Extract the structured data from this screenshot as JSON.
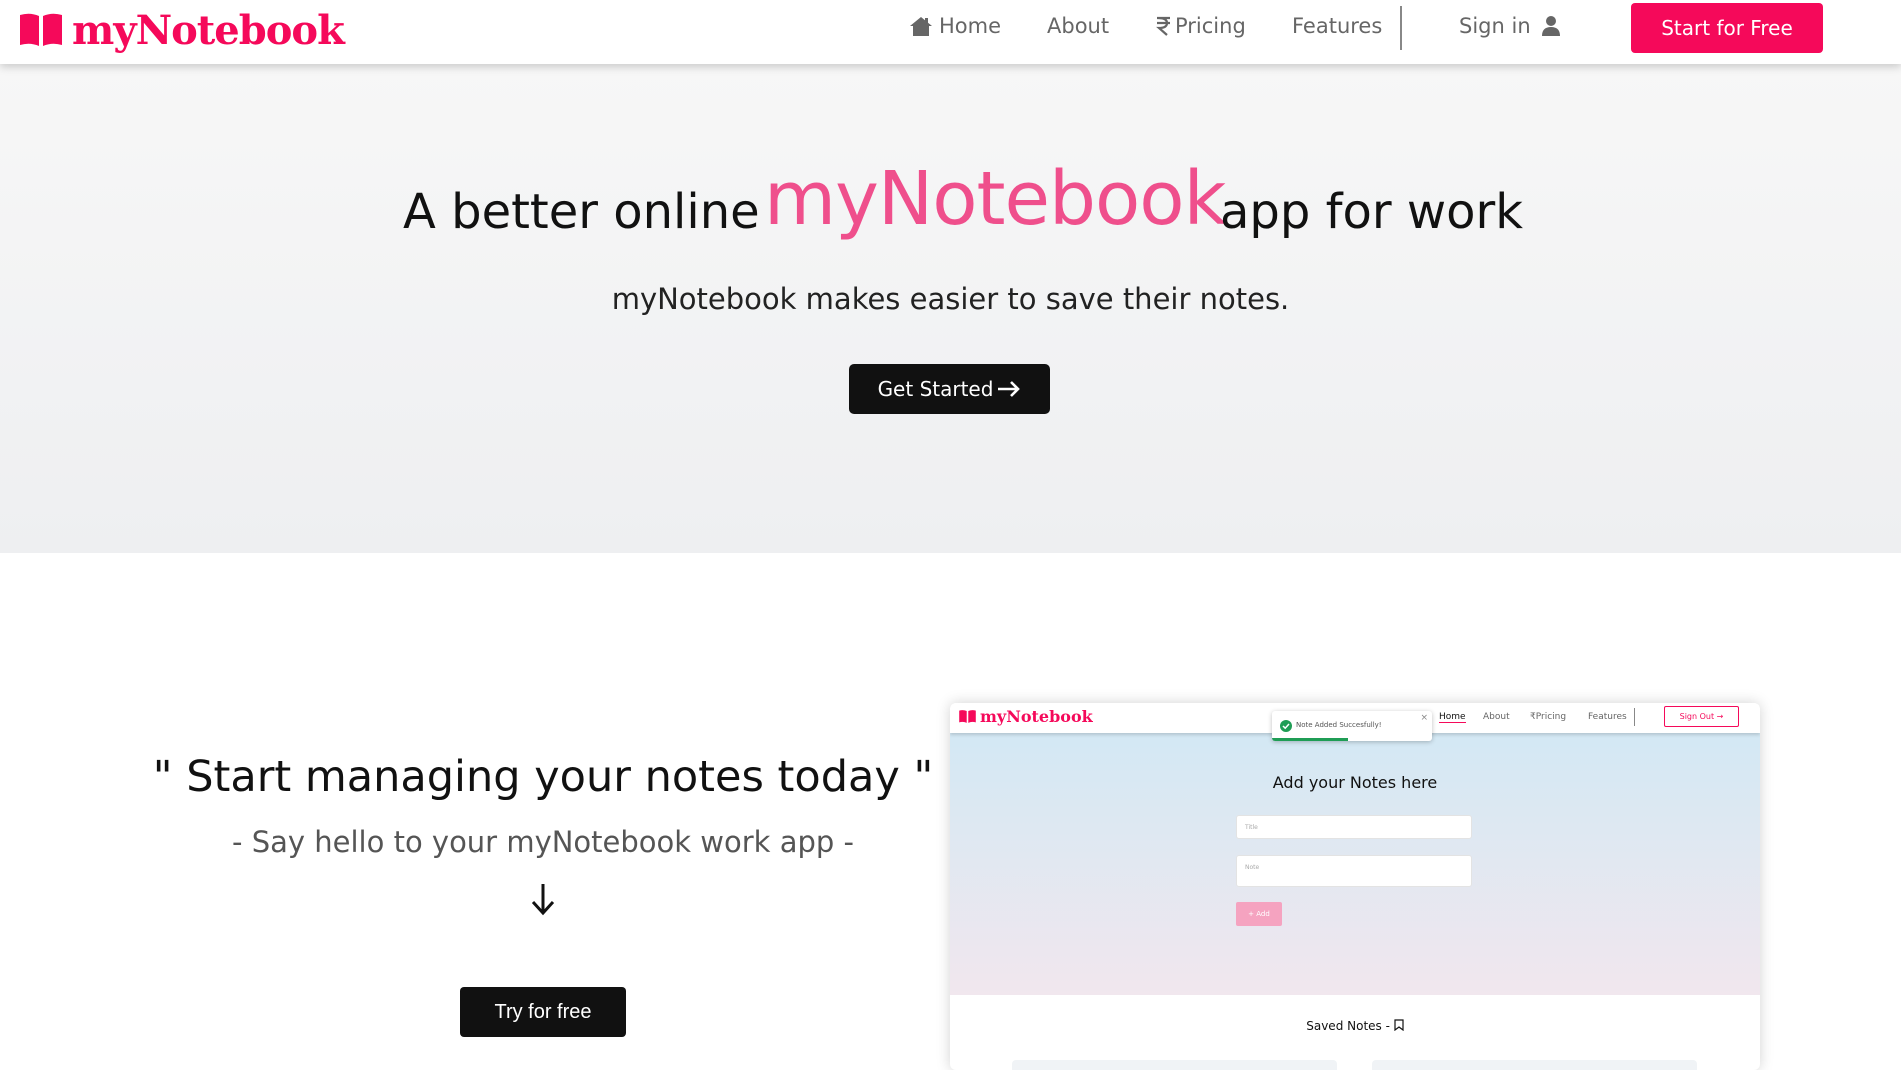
{
  "nav": {
    "brand": "myNotebook",
    "links": [
      {
        "label": "Home",
        "icon": "home-icon"
      },
      {
        "label": "About"
      },
      {
        "label": "Pricing",
        "icon": "rupee-icon"
      },
      {
        "label": "Features"
      },
      {
        "label": "Sign in",
        "icon": "user-icon"
      }
    ],
    "cta": "Start for Free"
  },
  "hero": {
    "title_prefix": "A better online",
    "title_highlight": "myNotebook",
    "title_suffix": "app for work",
    "subtitle": "myNotebook makes easier to save their notes.",
    "button": "Get Started"
  },
  "section": {
    "heading": "\" Start managing your notes today \"",
    "subheading": "- Say hello to your myNotebook work app -",
    "button": "Try for free"
  },
  "preview": {
    "brand": "myNotebook",
    "links": [
      "Home",
      "About",
      "Pricing",
      "Features"
    ],
    "active_link": "Home",
    "signout": "Sign Out",
    "toast": "Note Added Succesfully!",
    "title": "Add your Notes here",
    "title_placeholder": "Title",
    "note_placeholder": "Note",
    "add_button": "+ Add",
    "saved_title": "Saved Notes -"
  },
  "colors": {
    "brand": "#f5095a",
    "highlight": "#ef4f8c",
    "dark_button": "#111111"
  }
}
